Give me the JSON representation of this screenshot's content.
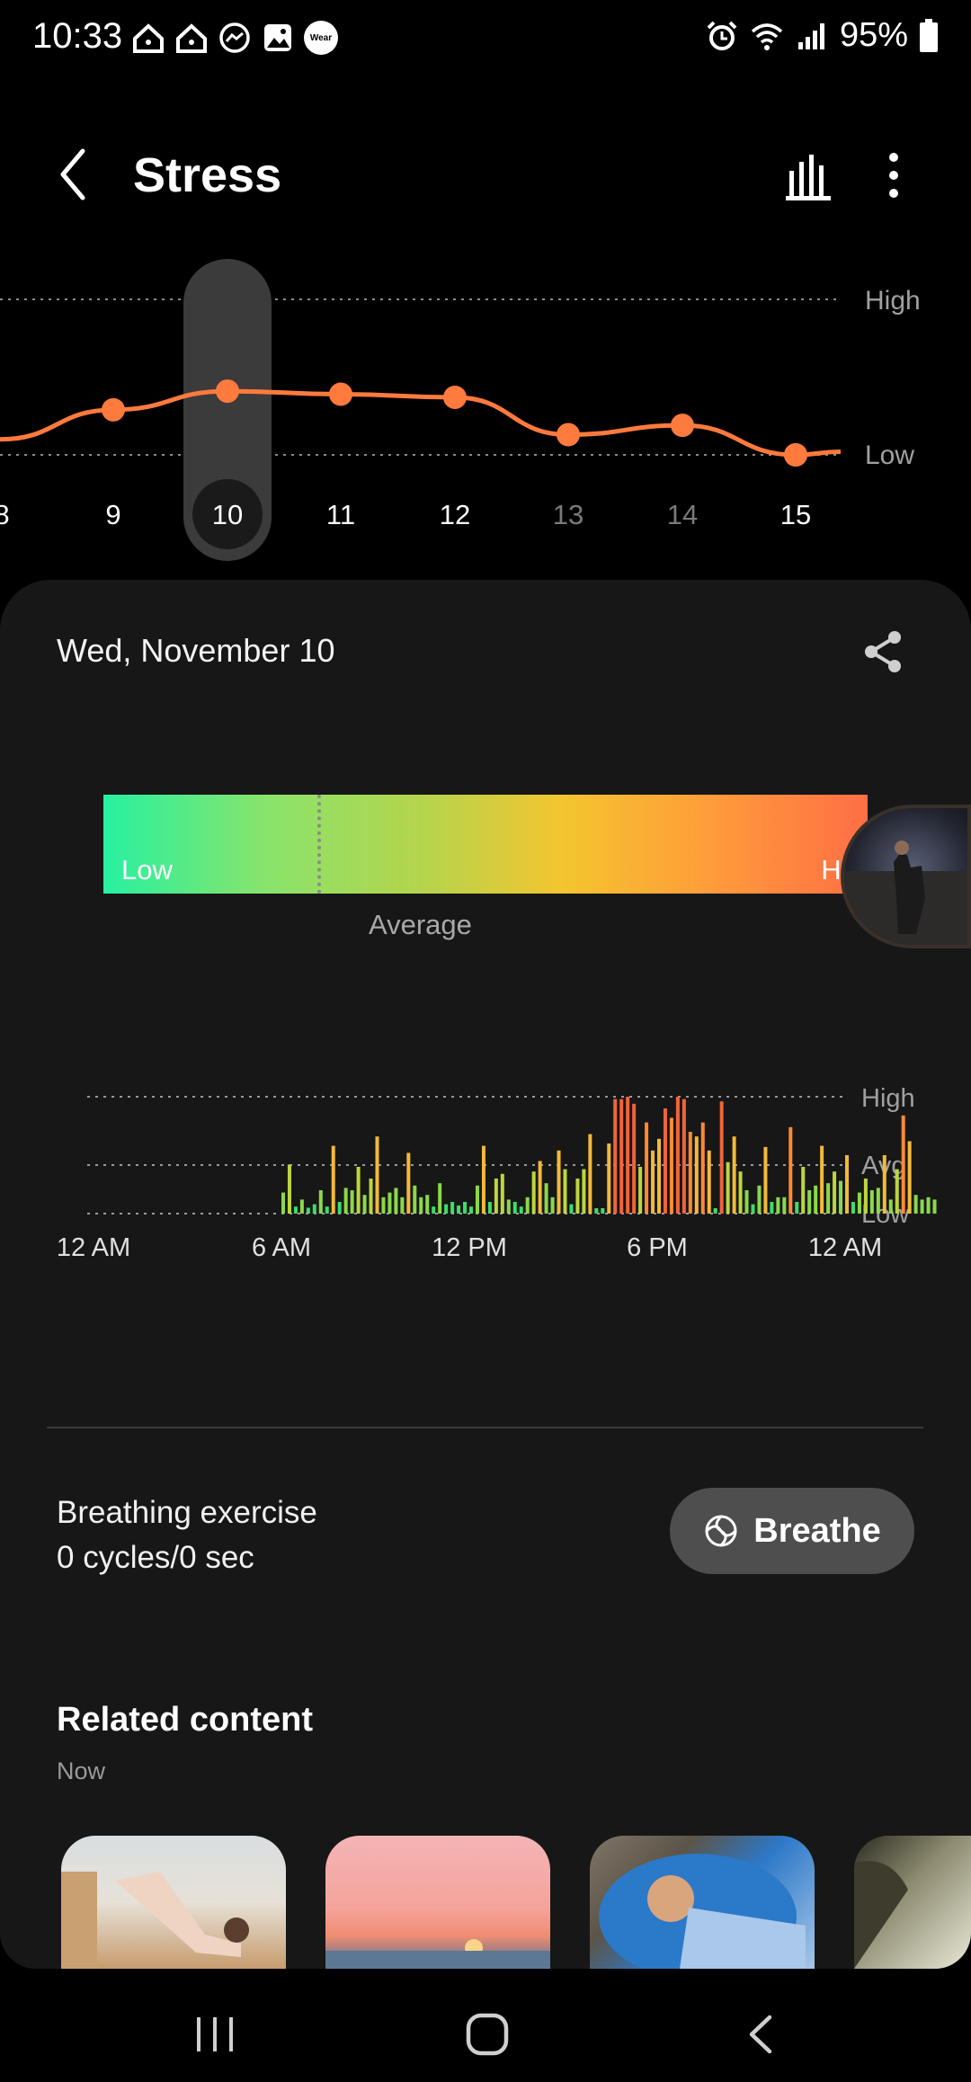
{
  "status_bar": {
    "time": "10:33",
    "battery": "95%",
    "wear_badge": "Wear",
    "left_icons": [
      "home-alert-icon",
      "home-alert-icon",
      "messenger-icon",
      "gallery-icon",
      "wear-icon"
    ],
    "right_icons": [
      "alarm-icon",
      "wifi-icon",
      "signal-icon",
      "battery-icon"
    ]
  },
  "header": {
    "title": "Stress",
    "icons": [
      "back-icon",
      "bar-chart-icon",
      "more-vertical-icon"
    ]
  },
  "trend": {
    "high_label": "High",
    "low_label": "Low",
    "days": [
      "8",
      "9",
      "10",
      "11",
      "12",
      "13",
      "14",
      "15"
    ],
    "selected_day": "10",
    "dim_days": [
      "13",
      "14"
    ],
    "levels": [
      0.1,
      0.29,
      0.41,
      0.39,
      0.37,
      0.13,
      0.19,
      0.0,
      0.02
    ],
    "line_color": "#ff7a3d"
  },
  "day_detail": {
    "date": "Wed, November 10",
    "share_icon": "share-icon",
    "gradient": {
      "low": "Low",
      "high": "High",
      "average_label": "Average",
      "average_position": 0.28
    },
    "chart": {
      "high_label": "High",
      "avg_label": "Avg.",
      "low_label": "Low",
      "x_labels": [
        "12 AM",
        "6 AM",
        "12 PM",
        "6 PM",
        "12 AM"
      ]
    }
  },
  "breathing": {
    "title": "Breathing exercise",
    "stat": "0 cycles/0 sec",
    "button_label": "Breathe",
    "button_icon": "breathe-swirl-icon"
  },
  "related": {
    "title": "Related content",
    "subtitle": "Now",
    "thumbnails": [
      "workout-photo",
      "sunset-beach-photo",
      "relaxing-man-photo",
      "forest-light-photo"
    ]
  },
  "nav": {
    "icons": [
      "recents-icon",
      "home-icon",
      "back-icon"
    ]
  },
  "chart_data": [
    {
      "type": "line",
      "x": [
        "8",
        "9",
        "10",
        "11",
        "12",
        "13",
        "14",
        "15"
      ],
      "series": [
        {
          "values": [
            0.29,
            0.41,
            0.39,
            0.37,
            0.13,
            0.19,
            0.0,
            0.02
          ]
        }
      ],
      "ylabel_ticks": [
        "Low",
        "High"
      ],
      "ylim": [
        0,
        1
      ],
      "selected": "10"
    },
    {
      "type": "bar",
      "x_ticks": [
        "12 AM",
        "6 AM",
        "12 PM",
        "6 PM",
        "12 AM"
      ],
      "y_ticks": [
        "Low",
        "Avg.",
        "High"
      ],
      "ylim": [
        0,
        1
      ],
      "x_start_hours": 6,
      "x_step_hours": 0.2,
      "values": [
        0.18,
        0.42,
        0.06,
        0.12,
        0.05,
        0.08,
        0.2,
        0.06,
        0.58,
        0.1,
        0.22,
        0.2,
        0.4,
        0.16,
        0.3,
        0.66,
        0.14,
        0.18,
        0.22,
        0.14,
        0.52,
        0.24,
        0.14,
        0.16,
        0.06,
        0.26,
        0.08,
        0.1,
        0.07,
        0.1,
        0.06,
        0.24,
        0.58,
        0.1,
        0.3,
        0.34,
        0.12,
        0.1,
        0.06,
        0.14,
        0.36,
        0.45,
        0.26,
        0.14,
        0.54,
        0.38,
        0.08,
        0.3,
        0.38,
        0.68,
        0.04,
        0.04,
        0.6,
        0.98,
        0.98,
        1.0,
        0.94,
        0.4,
        0.78,
        0.54,
        0.64,
        0.9,
        0.82,
        1.0,
        0.98,
        0.7,
        0.66,
        0.78,
        0.54,
        0.04,
        0.96,
        0.44,
        0.66,
        0.36,
        0.2,
        0.08,
        0.24,
        0.57,
        0.1,
        0.14,
        0.14,
        0.74,
        0.1,
        0.4,
        0.2,
        0.24,
        0.58,
        0.26,
        0.36,
        0.28,
        0.5,
        0.1,
        0.18,
        0.3,
        0.2,
        0.22,
        0.5,
        0.12,
        0.38,
        0.84,
        0.62,
        0.16,
        0.12,
        0.14,
        0.12
      ]
    }
  ]
}
